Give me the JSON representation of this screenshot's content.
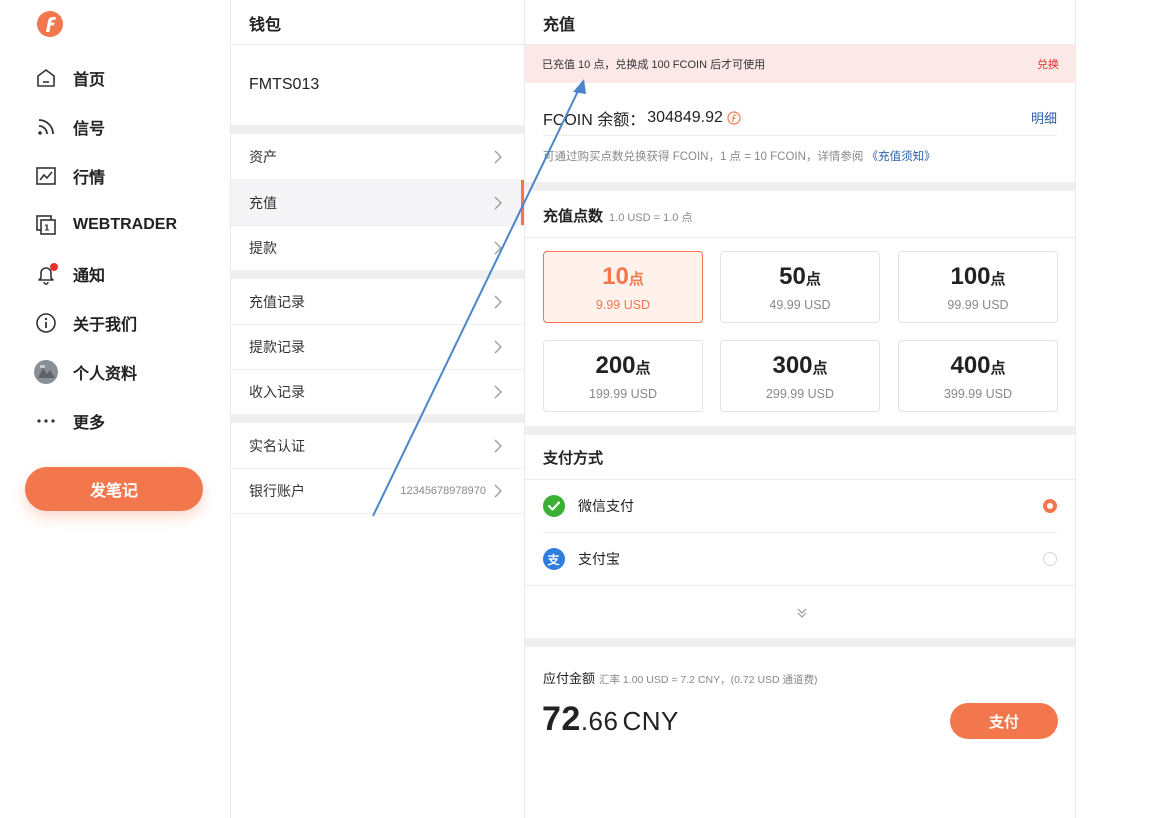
{
  "nav": {
    "items": [
      {
        "icon": "home-icon",
        "label": "首页"
      },
      {
        "icon": "signal-icon",
        "label": "信号"
      },
      {
        "icon": "market-chart-icon",
        "label": "行情"
      },
      {
        "icon": "webtrader-icon",
        "label": "WEBTRADER"
      },
      {
        "icon": "bell-icon",
        "label": "通知"
      },
      {
        "icon": "info-icon",
        "label": "关于我们"
      },
      {
        "icon": "avatar",
        "label": "个人资料"
      },
      {
        "icon": "more-icon",
        "label": "更多"
      }
    ],
    "compose_label": "发笔记",
    "accent": "#f2774d"
  },
  "wallet": {
    "title": "钱包",
    "account": "FMTS013",
    "menu": [
      {
        "label": "资产",
        "value": ""
      },
      {
        "label": "充值",
        "value": "",
        "active": true
      },
      {
        "label": "提款",
        "value": ""
      },
      {
        "label": "充值记录",
        "value": ""
      },
      {
        "label": "提款记录",
        "value": ""
      },
      {
        "label": "收入记录",
        "value": ""
      },
      {
        "label": "实名认证",
        "value": ""
      },
      {
        "label": "银行账户",
        "value": "12345678978970"
      }
    ]
  },
  "recharge": {
    "title": "充值",
    "notice": {
      "text": "已充值 10 点，兑换成 100 FCOIN 后才可使用",
      "link": "兑换",
      "color": "#e0302a"
    },
    "balance": {
      "label": "FCOIN 余额：",
      "value": "304849.92",
      "link": "明细"
    },
    "balance_note": {
      "text": "可通过购买点数兑换获得 FCOIN，1 点 = 10 FCOIN，详情参阅",
      "link": "《充值须知》"
    },
    "points_title": "充值点数",
    "points_rate": "1.0 USD = 1.0 点",
    "packages": [
      {
        "points": "10",
        "unit": "点",
        "price": "9.99  USD",
        "selected": true
      },
      {
        "points": "50",
        "unit": "点",
        "price": "49.99  USD"
      },
      {
        "points": "100",
        "unit": "点",
        "price": "99.99  USD"
      },
      {
        "points": "200",
        "unit": "点",
        "price": "199.99  USD"
      },
      {
        "points": "300",
        "unit": "点",
        "price": "299.99  USD"
      },
      {
        "points": "400",
        "unit": "点",
        "price": "399.99  USD"
      }
    ],
    "payment_title": "支付方式",
    "payments": [
      {
        "icon": "wechat-pay-icon",
        "label": "微信支付",
        "selected": true
      },
      {
        "icon": "alipay-icon",
        "label": "支付宝",
        "selected": false
      }
    ],
    "amount_label": "应付金额",
    "amount_rate": "汇率 1.00 USD = 7.2 CNY，(0.72 USD 通道费)",
    "amount_int": "72",
    "amount_dec": ".66",
    "amount_currency": "CNY",
    "pay_label": "支付"
  }
}
